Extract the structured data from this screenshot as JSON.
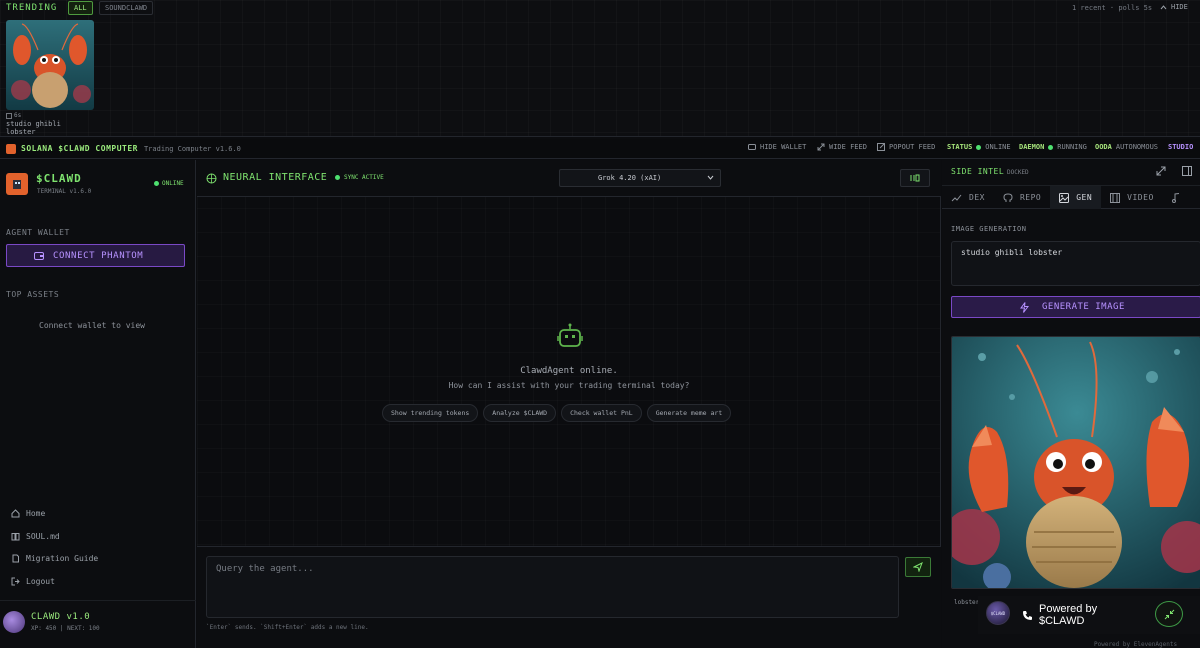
{
  "trending": {
    "title": "TRENDING",
    "filters": [
      "ALL",
      "SOUNDCLAWD"
    ],
    "active_filter": "ALL",
    "status": "1 recent · polls 5s",
    "hide_label": "HIDE",
    "card": {
      "age": "6s",
      "caption": "studio ghibli lobster"
    }
  },
  "topbar": {
    "title": "SOLANA $CLAWD COMPUTER",
    "version": "Trading Computer v1.6.0",
    "hide_wallet": "HIDE WALLET",
    "wide_feed": "WIDE FEED",
    "popout_feed": "POPOUT FEED",
    "status_key": "STATUS",
    "status_val": "ONLINE",
    "daemon_key": "DAEMON",
    "daemon_val": "RUNNING",
    "ooda_key": "OODA",
    "ooda_val": "AUTONOMOUS",
    "studio_key": "STUDIO"
  },
  "sidebar": {
    "brand": "$CLAWD",
    "brand_sub": "TERMINAL v1.6.0",
    "online": "ONLINE",
    "wallet_label": "AGENT WALLET",
    "connect_label": "CONNECT PHANTOM",
    "assets_label": "TOP ASSETS",
    "assets_empty": "Connect wallet to view",
    "nav": [
      "Home",
      "SOUL.md",
      "Migration Guide",
      "Logout"
    ],
    "user_name": "CLAWD v1.0",
    "user_xp": "XP: 450 | NEXT: 100"
  },
  "center": {
    "title": "NEURAL INTERFACE",
    "sync": "SYNC ACTIVE",
    "model": "Grok 4.20 (xAI)",
    "agent_online": "ClawdAgent online.",
    "agent_prompt": "How can I assist with your trading terminal today?",
    "suggestions": [
      "Show trending tokens",
      "Analyze $CLAWD",
      "Check wallet PnL",
      "Generate meme art"
    ],
    "query_placeholder": "Query the agent...",
    "hint": "`Enter` sends. `Shift+Enter` adds a new line."
  },
  "side_intel": {
    "title": "SIDE INTEL",
    "docked": "DOCKED",
    "tabs": [
      "DEX",
      "REPO",
      "GEN",
      "VIDEO"
    ],
    "active_tab": "GEN",
    "section_label": "IMAGE GENERATION",
    "prompt_value": "studio ghibli lobster",
    "generate_label": "GENERATE IMAGE",
    "image_caption": "lobster",
    "powered_by": "Powered by $CLAWD",
    "footer_note": "Powered by ElevenAgents"
  },
  "colors": {
    "accent_green": "#7fe36f",
    "accent_purple": "#b792ff",
    "background": "#0b0c0f"
  }
}
